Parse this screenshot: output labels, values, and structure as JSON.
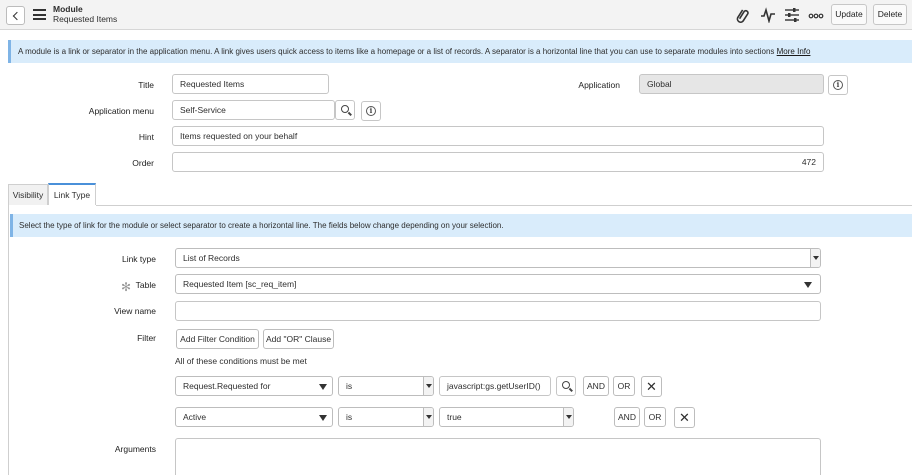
{
  "header": {
    "title": "Module",
    "subtitle": "Requested Items",
    "update_label": "Update",
    "delete_label": "Delete"
  },
  "info_banner": {
    "text": "A module is a link or separator in the application menu. A link gives users quick access to items like a homepage or a list of records. A separator is a horizontal line that you can use to separate modules into sections",
    "link": "More Info"
  },
  "form": {
    "title_label": "Title",
    "title_value": "Requested Items",
    "application_label": "Application",
    "application_value": "Global",
    "app_menu_label": "Application menu",
    "app_menu_value": "Self-Service",
    "hint_label": "Hint",
    "hint_value": "Items requested on your behalf",
    "order_label": "Order",
    "order_value": "472"
  },
  "tabs": [
    {
      "label": "Visibility"
    },
    {
      "label": "Link Type"
    }
  ],
  "link_type_section": {
    "banner": "Select the type of link for the module or select separator to create a horizontal line. The fields below change depending on your selection.",
    "link_type_label": "Link type",
    "link_type_value": "List of Records",
    "table_label": "Table",
    "table_value": "Requested Item [sc_req_item]",
    "view_name_label": "View name",
    "view_name_value": "",
    "filter_label": "Filter",
    "add_filter_label": "Add Filter Condition",
    "add_or_label": "Add \"OR\" Clause",
    "conditions_heading": "All of these conditions must be met",
    "conditions": [
      {
        "field": "Request.Requested for",
        "operator": "is",
        "value": "javascript:gs.getUserID()",
        "and": "AND",
        "or": "OR"
      },
      {
        "field": "Active",
        "operator": "is",
        "value": "true",
        "and": "AND",
        "or": "OR"
      }
    ],
    "arguments_label": "Arguments"
  }
}
